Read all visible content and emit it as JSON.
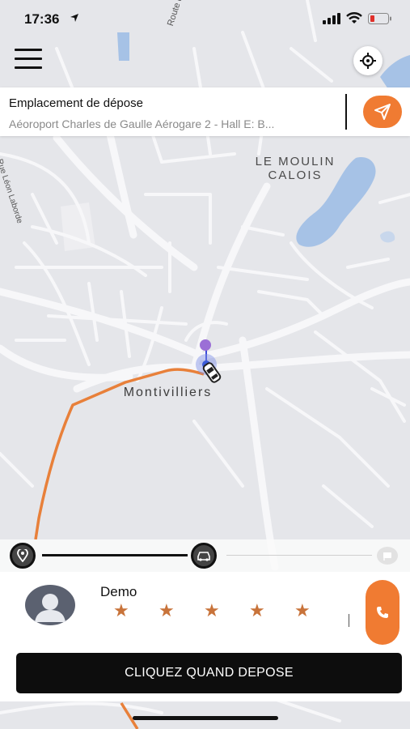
{
  "status_bar": {
    "time": "17:36"
  },
  "header": {
    "menu_icon": "hamburger-icon",
    "locate_icon": "crosshair-icon"
  },
  "dropoff": {
    "title": "Emplacement de dépose",
    "address": "Aéoroport Charles de Gaulle Aérogare 2 - Hall E: B...",
    "send_icon": "send-arrow-icon"
  },
  "map": {
    "labels": {
      "district_line1": "LE MOULIN",
      "district_line2": "CALOIS",
      "town": "Montivilliers",
      "street_1": "Route des Fr",
      "street_2": "Rue Léon Laborde"
    },
    "colors": {
      "route": "#e8803a",
      "water": "#a6c2e6",
      "pin": "#9b6fd6",
      "accent": "#f07b32"
    }
  },
  "trip_progress": {
    "start_icon": "map-pin-icon",
    "current_icon": "car-icon",
    "end_icon": "flag-icon"
  },
  "driver": {
    "name": "Demo",
    "rating_stars": 5
  },
  "actions": {
    "dropped_label": "CLIQUEZ QUAND DEPOSE",
    "call_icon": "phone-icon"
  }
}
